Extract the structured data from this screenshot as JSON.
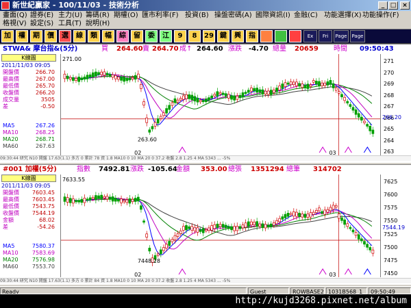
{
  "window": {
    "title": "新世紀贏家 - 100/11/03 - 技術分析"
  },
  "menu": [
    "畫面(Q)",
    "證券(E)",
    "主力(U)",
    "籌碼(R)",
    "期權(O)",
    "匯市利率(F)",
    "投資(B)",
    "操盤密碼(A)",
    "國際資訊(I)",
    "金融(C)",
    "功能選擇(X)",
    "功能操作(F)",
    "格視(V)",
    "設定(S)",
    "工具(T)",
    "說明(H)"
  ],
  "toolbar": [
    "加",
    "權",
    "期",
    "價",
    "選",
    "線",
    "類",
    "幅",
    "綜",
    "留",
    "委",
    "江",
    "9",
    "8",
    "29",
    "鍵",
    "興",
    "指",
    "",
    "",
    "",
    "Ex",
    "Fri",
    "Page\nTop",
    "Page\nBtm"
  ],
  "panel1": {
    "symbol": "STWA& 摩台指&(5分)",
    "buy_label": "買",
    "buy": "264.60",
    "sell_label": "賣",
    "sell": "264.70",
    "deal_label": "成↑",
    "deal": "264.60",
    "change_label": "漲跌",
    "change": "-4.70",
    "volume_label": "總量",
    "volume": "20659",
    "time_label": "時間",
    "time": "09:50:43",
    "kbox": "K線圖",
    "date": "2011/11/03 09:05",
    "stats": [
      [
        "開盤價",
        "266.70"
      ],
      [
        "最高價",
        "267.00"
      ],
      [
        "最低價",
        "265.70"
      ],
      [
        "收盤價",
        "266.20"
      ],
      [
        "成交量",
        "3505"
      ],
      [
        "差",
        "-0.50"
      ]
    ],
    "ma": [
      [
        "MA5",
        "267.26"
      ],
      [
        "MA10",
        "268.25"
      ],
      [
        "MA20",
        "268.71"
      ],
      [
        "MA60",
        "267.63"
      ]
    ],
    "yticks": [
      "271",
      "270",
      "269",
      "268",
      "267",
      "266",
      "265",
      "264",
      "263"
    ],
    "last_badge": "266.20",
    "ann_high": "271.00",
    "ann_low": "263.60",
    "xticks": [
      "02",
      "03"
    ],
    "minibar": "09:30:44  研究 N10   開盤 17.63(1.1)  多方 0   累計 78 資 1.8  MA10 0 10  MA 20 0 37.2  收盤 2.8 1.25 4 MA 5343  ...  -5%"
  },
  "panel2": {
    "symbol": "#001 加權(5分)",
    "idx_label": "指數",
    "idx": "7492.81",
    "change_label": "漲跌",
    "change": "-105.64",
    "amt_label": "金額",
    "amt": "353.00",
    "vol_label": "總張",
    "vol": "1351294",
    "cnt_label": "總筆",
    "cnt": "314702",
    "kbox": "K線圖",
    "date": "2011/11/03 09:05",
    "stats": [
      [
        "開盤價",
        "7603.45"
      ],
      [
        "最高價",
        "7603.45"
      ],
      [
        "最低價",
        "7543.75"
      ],
      [
        "收盤價",
        "7544.19"
      ],
      [
        "金額",
        "68.02"
      ],
      [
        "差",
        "-54.26"
      ]
    ],
    "ma": [
      [
        "MA5",
        "7580.37"
      ],
      [
        "MA10",
        "7583.69"
      ],
      [
        "MA20",
        "7576.98"
      ],
      [
        "MA60",
        "7553.70"
      ]
    ],
    "yticks": [
      "7625",
      "7600",
      "7575",
      "7550",
      "7525",
      "7500",
      "7475",
      "7450"
    ],
    "last_badge": "7544.19",
    "ann_high": "7633.55",
    "ann_low": "7448.28",
    "xticks": [
      "02",
      "03"
    ],
    "minibar": "09:30:44  研究 N10   開盤 17.63(1.1)  多方 0   累計 84 資 1.8  MA10 0 10  MA 20 0 37.2  收盤 2.8 1.25 4 MA 5343  ...  -5%"
  },
  "status": {
    "ready": "Ready",
    "guest": "Guest",
    "server": "ROWBASE2",
    "code": "1031B568_1",
    "clock": "09:50:49"
  },
  "watermark": "http://kujd3268.pixnet.net/album",
  "colors": {
    "up": "#d00000",
    "down": "#00a000",
    "ma5": "#0000ff",
    "ma10": "#c000c0",
    "ma20": "#008000",
    "ma60": "#404040"
  }
}
